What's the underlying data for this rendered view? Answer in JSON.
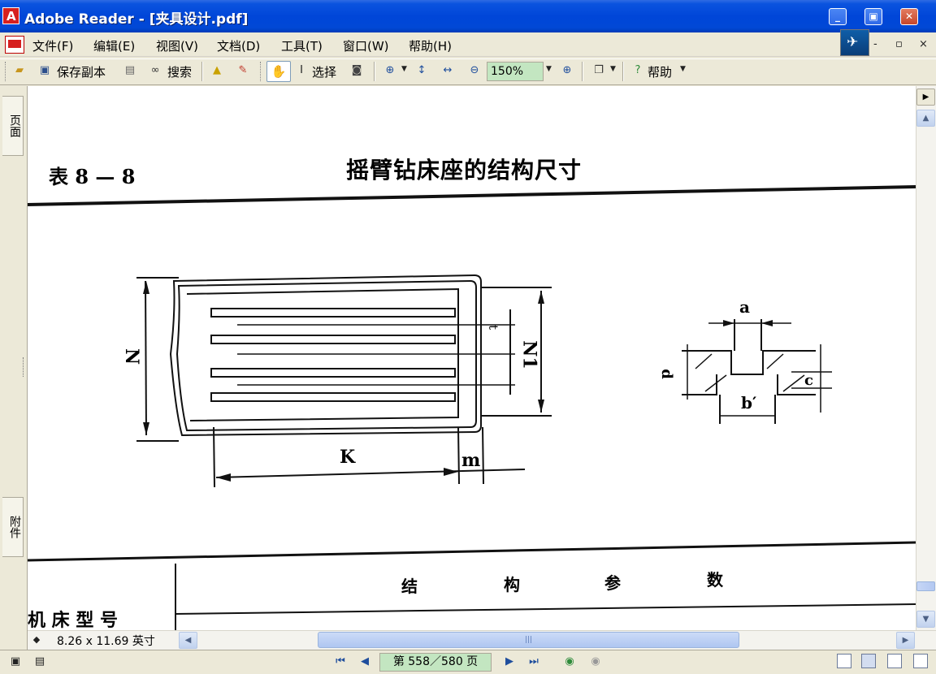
{
  "window": {
    "title": "Adobe Reader - [夹具设计.pdf]",
    "min": "_",
    "max": "▣",
    "close": "✕"
  },
  "menu": [
    {
      "label": "文件(F)"
    },
    {
      "label": "编辑(E)"
    },
    {
      "label": "视图(V)"
    },
    {
      "label": "文档(D)"
    },
    {
      "label": "工具(T)"
    },
    {
      "label": "窗口(W)"
    },
    {
      "label": "帮助(H)"
    }
  ],
  "mdi": {
    "min": "-",
    "restore": "▫",
    "close": "×"
  },
  "toolbar": {
    "save_copy": "保存副本",
    "search": "搜索",
    "select": "选择",
    "zoom": "150%",
    "help": "帮助"
  },
  "side_tabs": {
    "pages": "页面",
    "attachments": "附件"
  },
  "document": {
    "table_number": "表 8 — 8",
    "heading": "摇臂钻床座的结构尺寸",
    "dim_labels": {
      "N": "N",
      "N1": "N1",
      "K": "K",
      "m": "m",
      "t": "t",
      "a": "a",
      "b": "b′",
      "c": "c",
      "d": "d"
    },
    "column_header": [
      "结",
      "构",
      "参",
      "数"
    ],
    "row_header": "机 床 型 号"
  },
  "status": {
    "page_size": "8.26 x 11.69 英寸",
    "page_indicator": "第 558／580 页"
  }
}
